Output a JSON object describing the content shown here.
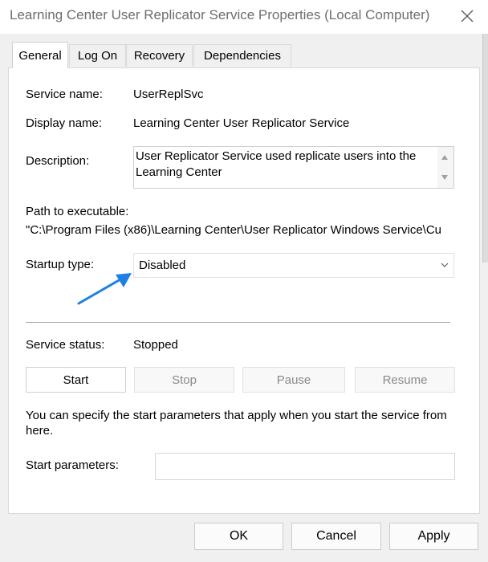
{
  "window": {
    "title": "Learning Center User Replicator Service Properties (Local Computer)"
  },
  "tabs": [
    {
      "label": "General",
      "active": true
    },
    {
      "label": "Log On",
      "active": false
    },
    {
      "label": "Recovery",
      "active": false
    },
    {
      "label": "Dependencies",
      "active": false
    }
  ],
  "general": {
    "service_name_label": "Service name:",
    "service_name_value": "UserReplSvc",
    "display_name_label": "Display name:",
    "display_name_value": "Learning Center User Replicator Service",
    "description_label": "Description:",
    "description_value": "User Replicator Service used replicate users into the Learning Center",
    "path_label": "Path to executable:",
    "path_value": "\"C:\\Program Files (x86)\\Learning Center\\User Replicator Windows Service\\Cu",
    "startup_type_label": "Startup type:",
    "startup_type_value": "Disabled",
    "service_status_label": "Service status:",
    "service_status_value": "Stopped",
    "buttons": {
      "start": "Start",
      "stop": "Stop",
      "pause": "Pause",
      "resume": "Resume"
    },
    "info_text": "You can specify the start parameters that apply when you start the service from here.",
    "start_params_label": "Start parameters:",
    "start_params_value": ""
  },
  "footer": {
    "ok": "OK",
    "cancel": "Cancel",
    "apply": "Apply"
  },
  "icons": {
    "close": "close-icon",
    "chevron": "chevron-down-icon",
    "annotation": "arrow-annotation-icon"
  },
  "colors": {
    "annotation_arrow": "#1e7fe6",
    "disabled_text": "#8a8a8a",
    "title_text": "#6e6e6e"
  }
}
